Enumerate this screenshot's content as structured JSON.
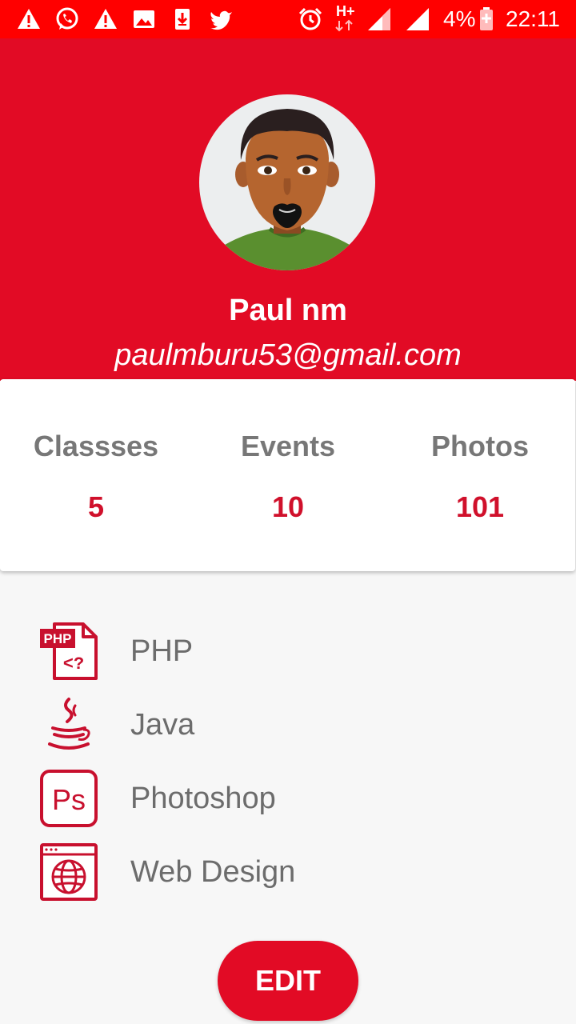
{
  "status_bar": {
    "battery": "4%",
    "time": "22:11",
    "network": "H+",
    "color": "#ff0000"
  },
  "profile": {
    "name": "Paul nm",
    "email": "paulmburu53@gmail.com",
    "header_color": "#e20b25"
  },
  "stats": [
    {
      "label": "Classses",
      "value": "5"
    },
    {
      "label": "Events",
      "value": "10"
    },
    {
      "label": "Photos",
      "value": "101"
    }
  ],
  "skills": [
    {
      "label": "PHP",
      "icon": "php-file-icon",
      "icon_text": "PHP"
    },
    {
      "label": "Java",
      "icon": "java-cup-icon"
    },
    {
      "label": "Photoshop",
      "icon": "photoshop-icon",
      "icon_text": "Ps"
    },
    {
      "label": "Web Design",
      "icon": "web-design-icon"
    }
  ],
  "edit_button": {
    "label": "EDIT"
  }
}
